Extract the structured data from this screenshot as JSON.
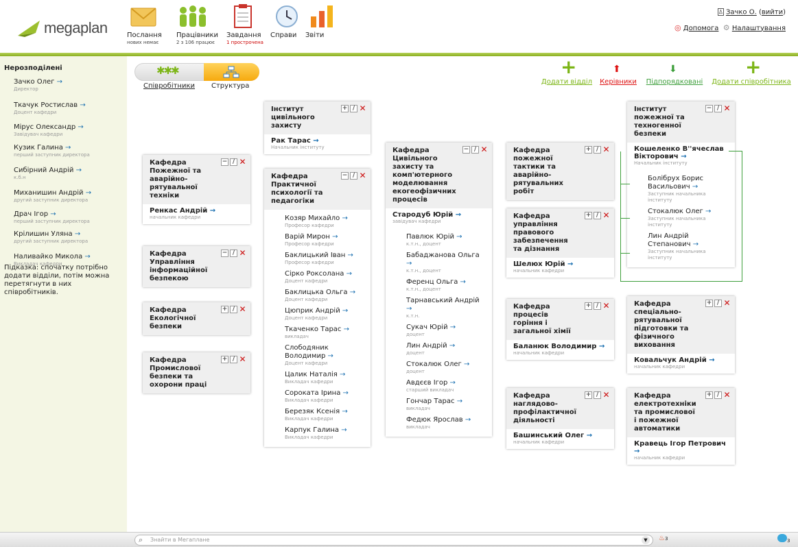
{
  "app": {
    "logo_text": "megaplan"
  },
  "nav": [
    {
      "label": "Послання",
      "sub": "нових немає",
      "icon": "envelope-icon",
      "subred": false
    },
    {
      "label": "Працівники",
      "sub": "2 з 106 працює",
      "icon": "people-icon",
      "subred": false
    },
    {
      "label": "Завдання",
      "sub": "1 прострочена",
      "icon": "tasks-icon",
      "subred": true
    },
    {
      "label": "Справи",
      "sub": "",
      "icon": "clock-icon",
      "subred": false
    },
    {
      "label": "Звіти",
      "sub": "",
      "icon": "chart-icon",
      "subred": false
    }
  ],
  "user": {
    "name": "Зачко О.",
    "logout": "вийти",
    "help": "Допомога",
    "settings": "Налаштування"
  },
  "sidebar": {
    "title": "Нерозподілені",
    "people": [
      {
        "name": "Зачко Олег",
        "role": "Директор"
      },
      {
        "name": "Ткачук Ростислав",
        "role": "Доцент кафедри"
      },
      {
        "name": "Міруc Олександр",
        "role": "Завідувач кафедри"
      },
      {
        "name": "Кузик Галина",
        "role": "перший заступник директора"
      },
      {
        "name": "Сибірний Андрій",
        "role": "к.б.н"
      },
      {
        "name": "Миханишин Андрій",
        "role": "другий заступник директора"
      },
      {
        "name": "Драч Ігор",
        "role": "перший заступник директора"
      },
      {
        "name": "Крілишин Уляна",
        "role": "другий заступник директора"
      },
      {
        "name": "Наливайко Микола",
        "role": "Викладач кафедри"
      }
    ],
    "hint": "Підказка: спочатку потрібно додати відділи, потім можна перетягнути в них співробітників."
  },
  "tabs": {
    "employees": "Співробітники",
    "structure": "Структура"
  },
  "actions": {
    "add_dept": "Додати відділ",
    "managers": "Керівники",
    "subordinates": "Підпорядковані",
    "add_employee": "Додати співробітника"
  },
  "cards": {
    "c1": {
      "title": "Кафедра Пожежної та аварійно-рятувальної техніки",
      "head": "Ренкас Андрій",
      "head_role": "начальник кафедри",
      "emps": []
    },
    "c2": {
      "title": "Кафедра Управління інформаційної безпекою",
      "head": "",
      "head_role": "",
      "emps": []
    },
    "c3": {
      "title": "Кафедра Екологічної безпеки",
      "head": "",
      "head_role": "",
      "emps": []
    },
    "c4": {
      "title": "Кафедра Промислової безпеки та охорони праці",
      "head": "",
      "head_role": "",
      "emps": []
    },
    "c5": {
      "title": "Інститут цивільного захисту",
      "head": "Рак Тарас",
      "head_role": "Начальник інституту",
      "emps": []
    },
    "c6": {
      "title": "Кафедра Практичної психології та педагогіки",
      "head": "",
      "head_role": "",
      "emps": [
        {
          "name": "Козяр Михайло",
          "role": "Професор кафедри"
        },
        {
          "name": "Варій Мирон",
          "role": "Професор кафедри"
        },
        {
          "name": "Баклицький Іван",
          "role": "Професор кафедри"
        },
        {
          "name": "Сірко Роксолана",
          "role": "Доцент кафедри"
        },
        {
          "name": "Баклицька Ольга",
          "role": "Доцент кафедри"
        },
        {
          "name": "Цюприк Андрій",
          "role": "Доцент кафедри"
        },
        {
          "name": "Ткаченко Тарас",
          "role": "викладач"
        },
        {
          "name": "Слободяник Володимир",
          "role": "Доцент кафедри"
        },
        {
          "name": "Цалик Наталія",
          "role": "Викладач кафедри"
        },
        {
          "name": "Сороката Ірина",
          "role": "Викладач кафедри"
        },
        {
          "name": "Березяк Ксенія",
          "role": "Викладач кафедри"
        },
        {
          "name": "Карпук Галина",
          "role": "Викладач кафедри"
        }
      ]
    },
    "c7": {
      "title": "Кафедра Цивільного захисту та комп'ютерного моделювання екогеофізичних процесів",
      "head": "Стародуб Юрій",
      "head_role": "завідувач кафедри",
      "emps": [
        {
          "name": "Павлюк Юрій",
          "role": "к.т.н., доцент"
        },
        {
          "name": "Бабаджанова Ольга",
          "role": "к.т.н., доцент"
        },
        {
          "name": "Ференц Ольга",
          "role": "к.т.н., доцент"
        },
        {
          "name": "Тарнавський Андрій",
          "role": "к.т.н."
        },
        {
          "name": "Сукач Юрій",
          "role": "доцент"
        },
        {
          "name": "Лин Андрій",
          "role": "доцент"
        },
        {
          "name": "Стокалюк Олег",
          "role": "доцент"
        },
        {
          "name": "Авдєєв Ігор",
          "role": "старший викладач"
        },
        {
          "name": "Гончар Тарас",
          "role": "викладач"
        },
        {
          "name": "Федюк Ярослав",
          "role": "викладач"
        }
      ]
    },
    "c8": {
      "title": "Кафедра пожежної тактики та аварійно-рятувальних робіт",
      "head": "",
      "head_role": "",
      "emps": []
    },
    "c9": {
      "title": "Кафедра управління правового забезпечення та дізнання",
      "head": "Шелюх Юрій",
      "head_role": "начальник кафедри",
      "emps": []
    },
    "c10": {
      "title": "Кафедра процесів горіння і загальної хімії",
      "head": "Баланюк Володимир",
      "head_role": "начальник кафедри",
      "emps": []
    },
    "c11": {
      "title": "Кафедра наглядово-профілактичної діяльності",
      "head": "Башинський Олег",
      "head_role": "начальник кафедри",
      "emps": []
    },
    "c12": {
      "title": "Інститут пожежної та техногенної безпеки",
      "head": "Кошеленко В''ячеслав Вікторович",
      "head_role": "Начальник інституту",
      "emps": [
        {
          "name": "Болібрух Борис Васильович",
          "role": "Заступник начальника інституту"
        },
        {
          "name": "Стокалюк Олег",
          "role": "Заступник начальника інституту"
        },
        {
          "name": "Лин Андрій Степанович",
          "role": "Заступник начальника інституту"
        }
      ]
    },
    "c13": {
      "title": "Кафедра спеціально-рятувальної підготовки та фізичного виховання",
      "head": "Ковальчук Андрій",
      "head_role": "начальник кафедри",
      "emps": []
    },
    "c14": {
      "title": "Кафедра електротехніки та промислової і пожежної автоматики",
      "head": "Кравець Ігор Петрович",
      "head_role": "начальник кафедри",
      "emps": []
    }
  },
  "bottom": {
    "search_placeholder": "Знайти в Мегаплане",
    "alerts": "3",
    "chat": "3"
  }
}
